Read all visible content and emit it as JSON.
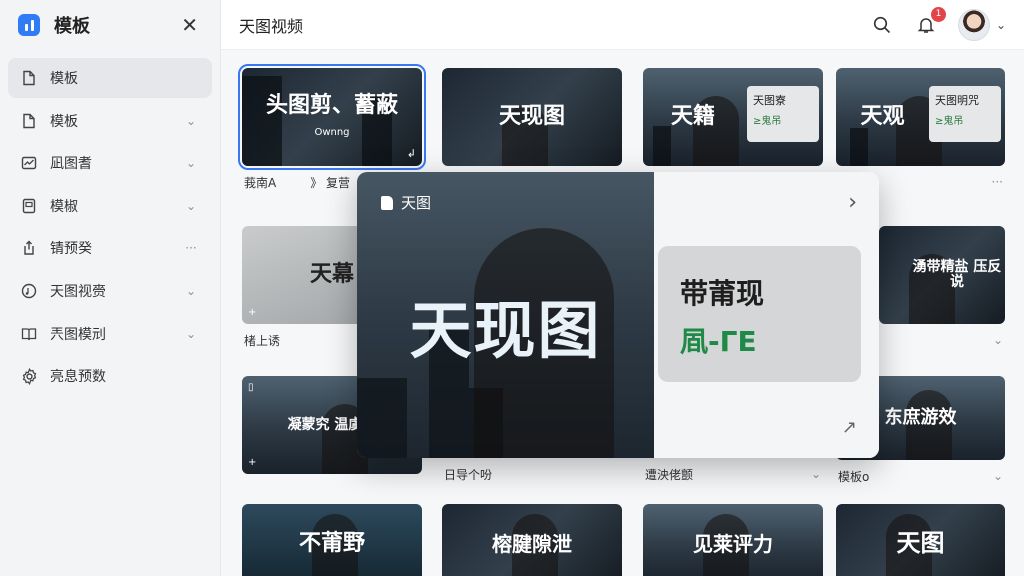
{
  "app": {
    "title": "模板"
  },
  "sidebar": {
    "items": [
      {
        "label": "模板",
        "trail": ""
      },
      {
        "label": "模板",
        "trail": "⌄"
      },
      {
        "label": "凪图耆",
        "trail": "⌄"
      },
      {
        "label": "模椒",
        "trail": "⌄"
      },
      {
        "label": "锖预癸",
        "trail": "···"
      },
      {
        "label": "天图视赍",
        "trail": "⌄"
      },
      {
        "label": "兲图模刓",
        "trail": "⌄"
      },
      {
        "label": "亮息预数",
        "trail": ""
      }
    ]
  },
  "header": {
    "title": "天图视频",
    "notification_count": "1"
  },
  "cards": [
    {
      "text": "头图剪、蓄蔽",
      "sub": "Ownng",
      "meta": "莪南A",
      "meta2": "》 复营",
      "more": ""
    },
    {
      "text": "天现图",
      "meta": "",
      "more": ""
    },
    {
      "text": "天籍",
      "panel_a": "天图寮",
      "panel_b": "≥鬼吊",
      "meta": "",
      "more": ""
    },
    {
      "text": "天观",
      "panel_a": "天图明咒",
      "panel_b": "≥鬼吊",
      "meta": "",
      "more": "···"
    },
    {
      "text": "天幕",
      "meta": "楮上诱",
      "more": ""
    },
    {
      "text": "",
      "meta": "",
      "more": ""
    },
    {
      "text": "",
      "meta": "",
      "more": ""
    },
    {
      "text": "湧带精盐 压反说",
      "meta": "",
      "more": "⌄"
    },
    {
      "text": "凝蒙究 温虞精",
      "meta": "",
      "more": ""
    },
    {
      "text": "",
      "meta": "日导个吩",
      "more": ""
    },
    {
      "text": "",
      "meta": "遭泱佬颤",
      "more": "⌄"
    },
    {
      "text": "东庶游效",
      "meta": "模板o",
      "more": "⌄"
    },
    {
      "text": "不莆野",
      "meta": "",
      "more": ""
    },
    {
      "text": "榕腱隙泄",
      "meta": "",
      "more": ""
    },
    {
      "text": "见莱评力",
      "meta": "",
      "more": ""
    },
    {
      "text": "天图",
      "meta": "",
      "more": ""
    }
  ],
  "popup": {
    "tag": "天图",
    "headline": "天现图",
    "card_line1": "带莆现",
    "card_line2": "凮-ГЕ"
  }
}
